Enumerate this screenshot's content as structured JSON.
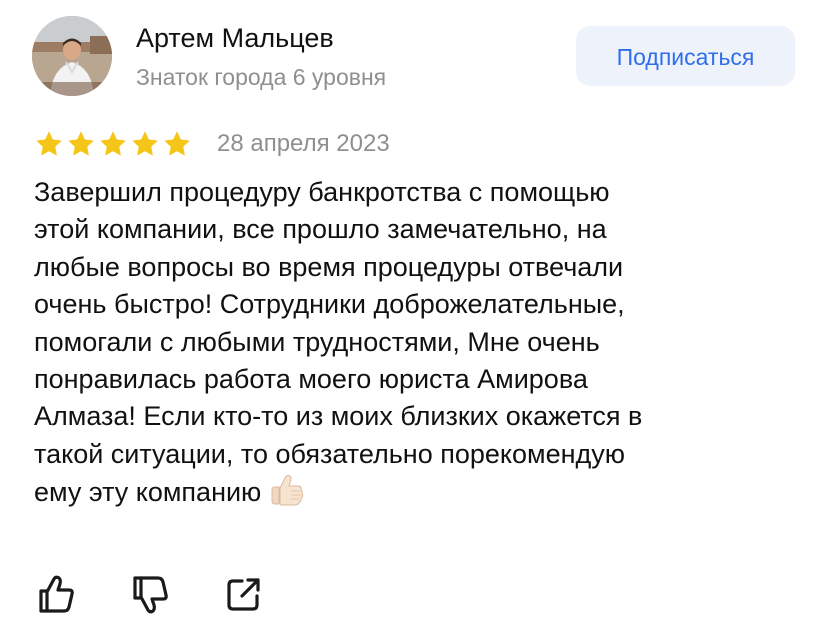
{
  "author": {
    "name": "Артем Мальцев",
    "level": "Знаток города 6 уровня",
    "avatar_icon": "user-photo"
  },
  "subscribe_button": {
    "label": "Подписаться",
    "color": "#2f6ee8",
    "background": "#eef3fb"
  },
  "rating": {
    "value": 5,
    "max": 5,
    "star_color": "#f5c518"
  },
  "date": "28 апреля 2023",
  "review": {
    "lines": [
      "Завершил процедуру банкротства с помощью",
      "этой компании, все прошло замечательно, на",
      "любые вопросы во время процедуры отвечали",
      "очень быстро! Сотрудники доброжелательные,",
      "помогали с любыми трудностями, Мне очень",
      "понравилась работа моего юриста Амирова",
      "Алмаза! Если кто-то из моих близких окажется в",
      "такой ситуации, то обязательно порекомендую",
      "ему эту компанию"
    ],
    "emoji": "thumbs-up-light-skin"
  },
  "actions": [
    {
      "name": "like",
      "icon": "thumbs-up-icon"
    },
    {
      "name": "dislike",
      "icon": "thumbs-down-icon"
    },
    {
      "name": "share",
      "icon": "share-icon"
    }
  ]
}
